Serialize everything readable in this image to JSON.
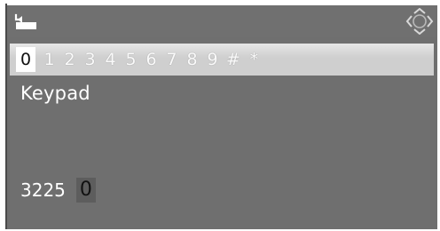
{
  "header": {
    "back_icon": "back-arrow-icon",
    "controller_icon": "joystick-direction-icon"
  },
  "keypad": {
    "selected_index": 0,
    "keys": [
      "0",
      "1",
      "2",
      "3",
      "4",
      "5",
      "6",
      "7",
      "8",
      "9",
      "#",
      "*"
    ]
  },
  "screen": {
    "title": "Keypad"
  },
  "entry": {
    "number": "3225",
    "current_digit": "0"
  },
  "colors": {
    "screen_background": "#6f6f6f",
    "digit_bar_background": "#cfcfcf",
    "selected_key_background": "#ffffff",
    "text": "#ffffff"
  }
}
